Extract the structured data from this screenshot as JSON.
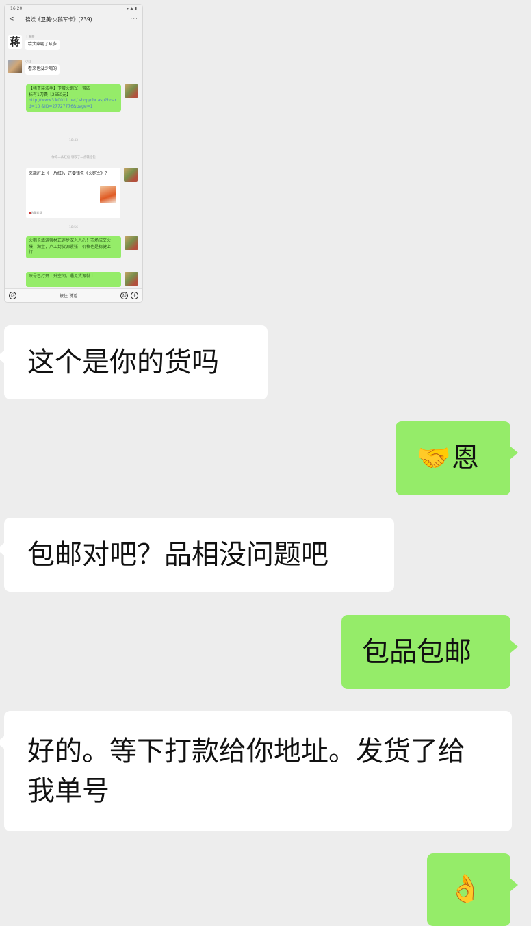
{
  "screenshot": {
    "status_time": "16:20",
    "status_icons": "▾ ▲ ▮",
    "back_symbol": "<",
    "title": "锦妖《卫美·火鹅军卡》(239)",
    "more_symbol": "···",
    "messages": [
      {
        "name": "上海哥",
        "text": "给大家呢了从多",
        "avatar_char": "蒋"
      },
      {
        "name": "小红",
        "text": "看来也没少喝的"
      },
      {
        "text_parts": [
          "【猪哥装法手】卫蛋火鹅军，带四",
          "标有1刀费【2650元】"
        ],
        "link": "http://www3.k0011.net/ shop/cbr.asp?board=10 &ID=27727776&page=1"
      },
      {
        "time": "18:43"
      },
      {
        "time": "你的一条红包 领取了一点钱红包"
      },
      {
        "card_text": "来能赶上《一片红》，还要错失《火鹅军》？",
        "card_source": "收藏转载"
      },
      {
        "time": "18:56"
      },
      {
        "text": "火鹅卡填源强材正逐步深入人心！市场成交火爆，淘宝，卢工封货源紧张：价格也是稳健上行！"
      },
      {
        "text": "账号已打开上升空间，遇见货源就上"
      }
    ],
    "voice_button": "按住 说话",
    "voice_icon": "◎",
    "sticker_icon": "☺",
    "plus_icon": "+"
  },
  "chat": [
    {
      "side": "in",
      "text": "这个是你的货吗"
    },
    {
      "side": "out",
      "emoji": "🤝",
      "text": "恩"
    },
    {
      "side": "in",
      "text": "包邮对吧？品相没问题吧"
    },
    {
      "side": "out",
      "text": "包品包邮"
    },
    {
      "side": "in",
      "text": "好的。等下打款给你地址。发货了给我单号"
    },
    {
      "side": "out",
      "emoji": "👌",
      "text": ""
    }
  ],
  "colors": {
    "background": "#ededed",
    "bubble_in": "#ffffff",
    "bubble_out": "#95ec69"
  }
}
